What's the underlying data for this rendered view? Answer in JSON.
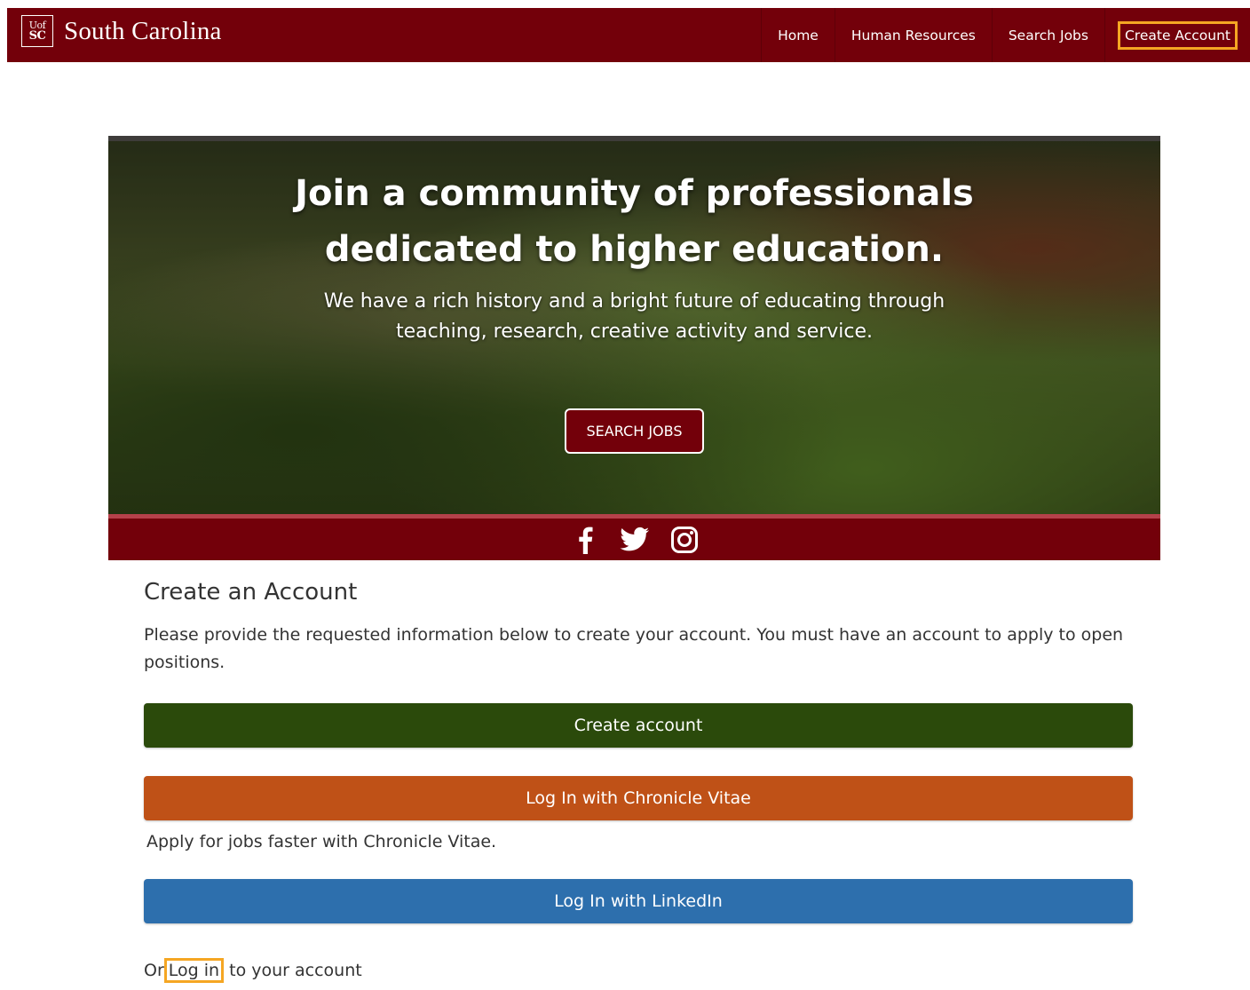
{
  "header": {
    "logo_top": "Uof",
    "logo_bottom": "SC",
    "brand_name": "South Carolina",
    "nav": [
      "Home",
      "Human Resources",
      "Search Jobs",
      "Create Account"
    ]
  },
  "hero": {
    "title_line1": "Join a community of professionals",
    "title_line2": "dedicated to higher education.",
    "subtitle": "We have a rich history and a bright future of educating through teaching, research, creative activity and service.",
    "button_label": "SEARCH JOBS"
  },
  "social": {
    "icons": [
      "facebook-icon",
      "twitter-icon",
      "instagram-icon"
    ]
  },
  "content": {
    "title": "Create an Account",
    "description": "Please provide the requested information below to create your account. You must have an account to apply to open positions.",
    "create_account_label": "Create account",
    "vitae_label": "Log In with Chronicle Vitae",
    "vitae_note": "Apply for jobs faster with Chronicle Vitae.",
    "linkedin_label": "Log In with LinkedIn",
    "login_prefix": "Or",
    "login_link": "Log in",
    "login_suffix": "to your account"
  },
  "colors": {
    "brand": "#73000a",
    "highlight": "#f5a623",
    "green": "#2b4a0b",
    "orange": "#bf5117",
    "blue": "#2d6fad"
  }
}
